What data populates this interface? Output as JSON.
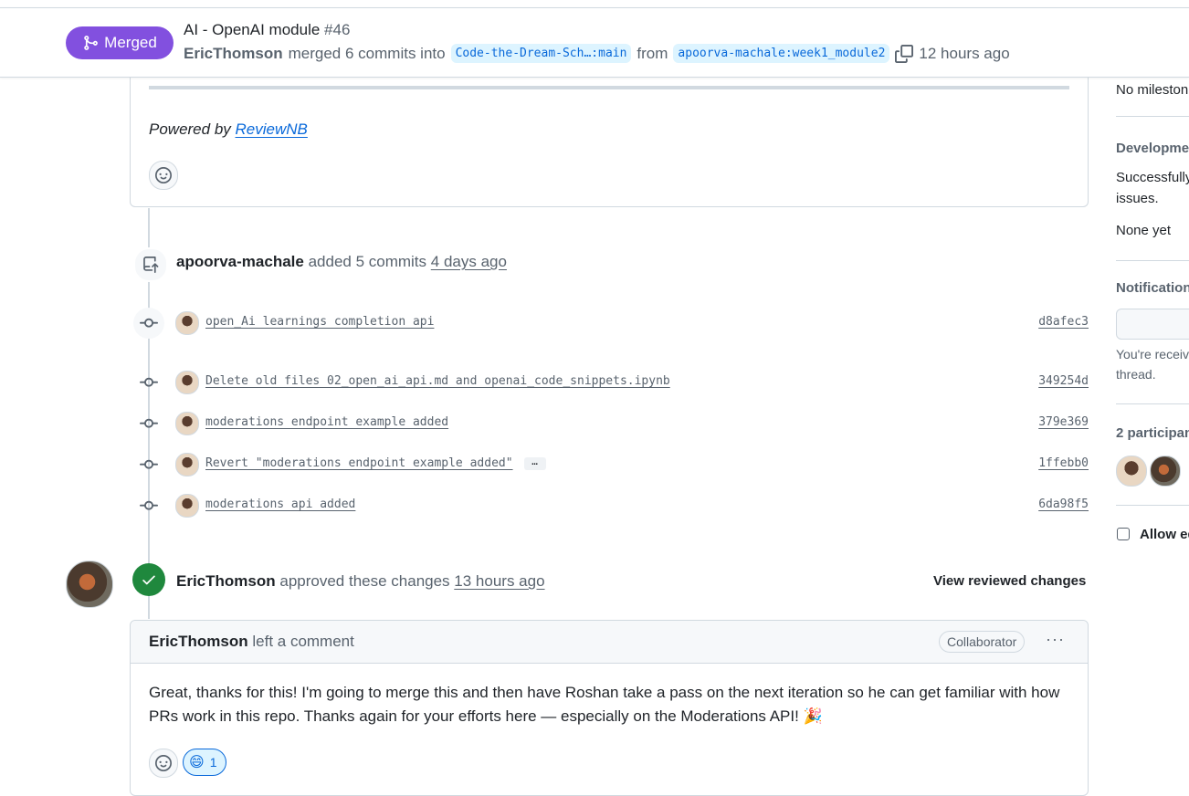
{
  "header": {
    "status_badge": "Merged",
    "title": "AI - OpenAI module",
    "number": "#46",
    "merged_by": "EricThomson",
    "merge_text": "merged 6 commits into",
    "base_branch": "Code-the-Dream-Sch…:main",
    "from_text": "from",
    "head_branch": "apoorva-machale:week1_module2",
    "time_ago": "12 hours ago"
  },
  "top_comment": {
    "powered_prefix": "Powered by",
    "powered_link": "ReviewNB"
  },
  "push_event": {
    "author": "apoorva-machale",
    "action": "added 5 commits",
    "time": "4 days ago"
  },
  "commits": [
    {
      "message": "open_Ai learnings completion api",
      "sha": "d8afec3"
    },
    {
      "message": "Delete old files 02_open_ai_api.md and openai_code_snippets.ipynb",
      "sha": "349254d"
    },
    {
      "message": "moderations endpoint example added",
      "sha": "379e369"
    },
    {
      "message": "Revert \"moderations endpoint example added\"",
      "sha": "1ffebb0",
      "more": "…"
    },
    {
      "message": "moderations api added",
      "sha": "6da98f5"
    }
  ],
  "review": {
    "author": "EricThomson",
    "action": "approved these changes",
    "time": "13 hours ago",
    "view_label": "View reviewed changes"
  },
  "comment": {
    "author": "EricThomson",
    "action": "left a comment",
    "role": "Collaborator",
    "menu": "···",
    "body": "Great, thanks for this! I'm going to merge this and then have Roshan take a pass on the next iteration so he can get familiar with how PRs work in this repo. Thanks again for your efforts here — especially on the Moderations API! 🎉",
    "reaction_emoji": "😄",
    "reaction_count": "1"
  },
  "sidebar": {
    "milestone": "No mileston",
    "development_heading": "Developmen",
    "development_line1": "Successfully",
    "development_line2": "issues.",
    "development_none": "None yet",
    "notifications_heading": "Notification",
    "notif_line1": "You're receiv",
    "notif_line2": "thread.",
    "participants_heading": "2 participan",
    "allow_edits": "Allow ed"
  },
  "colors": {
    "merged_purple": "#8250df",
    "approved_green": "#1f883d",
    "link_blue": "#0969da",
    "muted": "#59636e"
  }
}
